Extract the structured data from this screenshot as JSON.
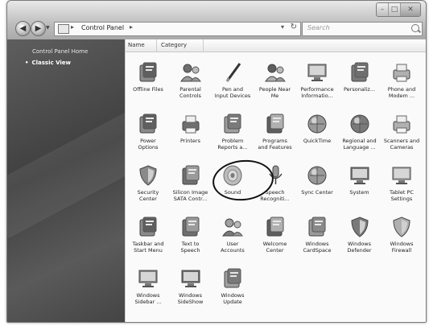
{
  "window": {
    "caption_buttons": [
      "–",
      "□",
      "✕"
    ]
  },
  "address": {
    "separator": "▸",
    "path": "Control Panel",
    "separator_end": "▸",
    "dropdown": "▾",
    "refresh": "↻"
  },
  "search": {
    "placeholder": "Search"
  },
  "sidebar": {
    "home_link": "Control Panel Home",
    "current": "Classic View",
    "bullet": "•"
  },
  "columns": {
    "name": "Name",
    "category": "Category"
  },
  "items": [
    {
      "label": "Offline Files",
      "icon": "folder-sync-icon"
    },
    {
      "label": "Parental\nControls",
      "icon": "parental-controls-icon"
    },
    {
      "label": "Pen and\nInput Devices",
      "icon": "pen-icon"
    },
    {
      "label": "People Near\nMe",
      "icon": "people-near-me-icon"
    },
    {
      "label": "Performance\nInformatio...",
      "icon": "performance-icon"
    },
    {
      "label": "Personaliz...",
      "icon": "personalization-icon"
    },
    {
      "label": "Phone and\nModem ...",
      "icon": "phone-icon"
    },
    {
      "label": "Power\nOptions",
      "icon": "power-icon"
    },
    {
      "label": "Printers",
      "icon": "printer-icon"
    },
    {
      "label": "Problem\nReports a...",
      "icon": "problem-reports-icon"
    },
    {
      "label": "Programs\nand Features",
      "icon": "programs-icon"
    },
    {
      "label": "QuickTime",
      "icon": "quicktime-icon"
    },
    {
      "label": "Regional and\nLanguage ...",
      "icon": "globe-icon"
    },
    {
      "label": "Scanners and\nCameras",
      "icon": "scanner-icon"
    },
    {
      "label": "Security\nCenter",
      "icon": "shield-icon"
    },
    {
      "label": "Silicon Image\nSATA Contr...",
      "icon": "sata-icon"
    },
    {
      "label": "Sound",
      "icon": "speaker-icon"
    },
    {
      "label": "Speech\nRecogniti...",
      "icon": "microphone-icon"
    },
    {
      "label": "Sync Center",
      "icon": "sync-icon"
    },
    {
      "label": "System",
      "icon": "computer-icon"
    },
    {
      "label": "Tablet PC\nSettings",
      "icon": "tablet-icon"
    },
    {
      "label": "Taskbar and\nStart Menu",
      "icon": "taskbar-icon"
    },
    {
      "label": "Text to\nSpeech",
      "icon": "text-to-speech-icon"
    },
    {
      "label": "User\nAccounts",
      "icon": "users-icon"
    },
    {
      "label": "Welcome\nCenter",
      "icon": "welcome-icon"
    },
    {
      "label": "Windows\nCardSpace",
      "icon": "cardspace-icon"
    },
    {
      "label": "Windows\nDefender",
      "icon": "defender-icon"
    },
    {
      "label": "Windows\nFirewall",
      "icon": "firewall-icon"
    },
    {
      "label": "Windows\nSidebar ...",
      "icon": "sidebar-icon"
    },
    {
      "label": "Windows\nSideShow",
      "icon": "sideshow-icon"
    },
    {
      "label": "Windows\nUpdate",
      "icon": "update-icon"
    }
  ]
}
